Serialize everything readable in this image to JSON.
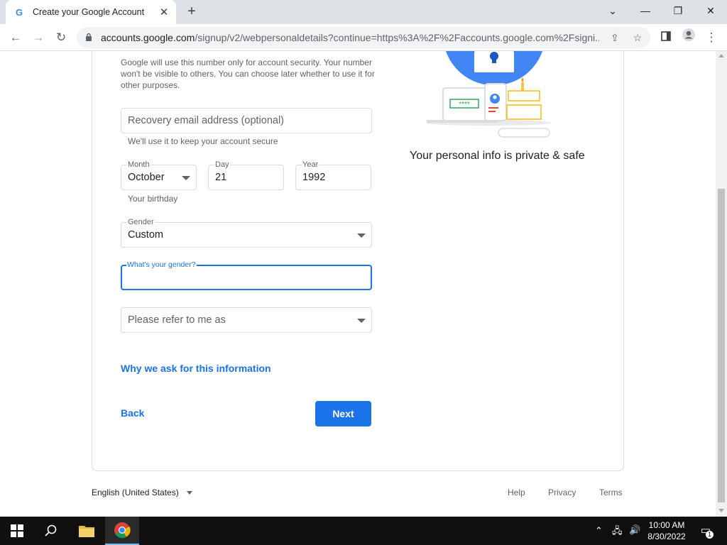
{
  "browser": {
    "tab_title": "Create your Google Account",
    "tab_icon": "G",
    "url_host": "accounts.google.com",
    "url_rest": "/signup/v2/webpersonaldetails?continue=https%3A%2F%2Faccounts.google.com%2Fsigni..."
  },
  "form": {
    "phone_helper": "Google will use this number only for account security. Your number won't be visible to others. You can choose later whether to use it for other purposes.",
    "recovery_email": {
      "placeholder": "Recovery email address (optional)",
      "hint": "We'll use it to keep your account secure"
    },
    "birthday": {
      "month_label": "Month",
      "month_value": "October",
      "day_label": "Day",
      "day_value": "21",
      "year_label": "Year",
      "year_value": "1992",
      "hint": "Your birthday"
    },
    "gender": {
      "label": "Gender",
      "value": "Custom"
    },
    "custom_gender": {
      "label": "What's your gender?",
      "value": ""
    },
    "pronoun": {
      "placeholder": "Please refer to me as"
    },
    "why_link": "Why we ask for this information",
    "back_label": "Back",
    "next_label": "Next"
  },
  "illustration": {
    "caption": "Your personal info is private & safe",
    "password_mask": "****"
  },
  "footer": {
    "language": "English (United States)",
    "help": "Help",
    "privacy": "Privacy",
    "terms": "Terms"
  },
  "taskbar": {
    "time": "10:00 AM",
    "date": "8/30/2022",
    "notification_count": "1"
  },
  "colors": {
    "accent": "#1a73e8",
    "taskbar": "#101010"
  }
}
